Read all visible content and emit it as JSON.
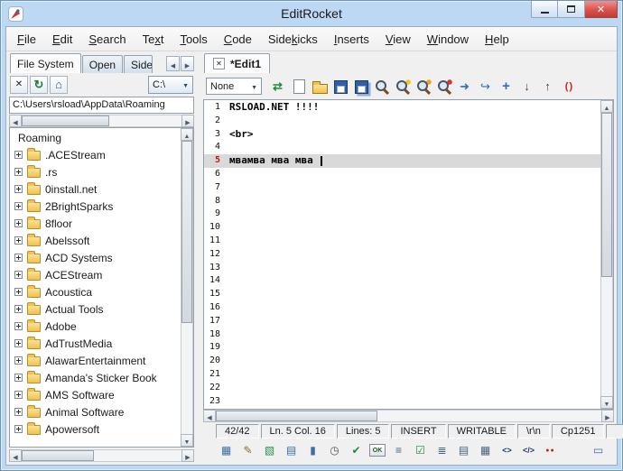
{
  "colors": {
    "titlebar": "#bdd8f2",
    "close_button": "#d9534f",
    "folder_yellow": "#f2c14e",
    "current_line_bg": "#d9d9d9",
    "current_line_number": "#cc1111",
    "accent_blue": "#2a6fc0"
  },
  "window": {
    "title": "EditRocket"
  },
  "menu": {
    "items": [
      {
        "pre": "",
        "u": "F",
        "post": "ile"
      },
      {
        "pre": "",
        "u": "E",
        "post": "dit"
      },
      {
        "pre": "",
        "u": "S",
        "post": "earch"
      },
      {
        "pre": "Te",
        "u": "x",
        "post": "t"
      },
      {
        "pre": "",
        "u": "T",
        "post": "ools"
      },
      {
        "pre": "",
        "u": "C",
        "post": "ode"
      },
      {
        "pre": "Side",
        "u": "k",
        "post": "icks"
      },
      {
        "pre": "",
        "u": "I",
        "post": "nserts"
      },
      {
        "pre": "",
        "u": "V",
        "post": "iew"
      },
      {
        "pre": "",
        "u": "W",
        "post": "indow"
      },
      {
        "pre": "",
        "u": "H",
        "post": "elp"
      }
    ]
  },
  "sidebar": {
    "tabs": [
      {
        "label": "File System",
        "active": true,
        "clip": false
      },
      {
        "label": "Open",
        "active": false,
        "clip": false
      },
      {
        "label": "Side",
        "active": false,
        "clip": true
      }
    ],
    "toolbar_icons": [
      {
        "name": "close-panel-icon",
        "glyph": "✕"
      },
      {
        "name": "refresh-icon",
        "glyph": "↻"
      },
      {
        "name": "home-icon",
        "glyph": "⌂"
      }
    ],
    "drive": "C:\\",
    "path": "C:\\Users\\rsload\\AppData\\Roaming",
    "tree_root": "Roaming",
    "folders": [
      ".ACEStream",
      ".rs",
      "0install.net",
      "2BrightSparks",
      "8floor",
      "Abelssoft",
      "ACD Systems",
      "ACEStream",
      "Acoustica",
      "Actual Tools",
      "Adobe",
      "AdTrustMedia",
      "AlawarEntertainment",
      "Amanda's Sticker Book",
      "AMS Software",
      "Animal Software",
      "Apowersoft"
    ]
  },
  "editor": {
    "tab": "*Edit1",
    "syntax_mode": "None",
    "toolbar_icons": [
      {
        "name": "connect-icon",
        "glyph": "⇄"
      },
      {
        "name": "new-file-icon",
        "glyph": ""
      },
      {
        "name": "open-file-icon",
        "glyph": ""
      },
      {
        "name": "save-icon",
        "glyph": ""
      },
      {
        "name": "save-all-icon",
        "glyph": ""
      },
      {
        "name": "find-icon",
        "glyph": ""
      },
      {
        "name": "find-next-icon",
        "glyph": ""
      },
      {
        "name": "find-prev-icon",
        "glyph": ""
      },
      {
        "name": "replace-icon",
        "glyph": ""
      },
      {
        "name": "goto-icon",
        "glyph": "➜"
      },
      {
        "name": "jump-line-icon",
        "glyph": "↪"
      },
      {
        "name": "insert-icon",
        "glyph": "+"
      },
      {
        "name": "move-down-icon",
        "glyph": "↓"
      },
      {
        "name": "move-up-icon",
        "glyph": "↑"
      },
      {
        "name": "match-brace-icon",
        "glyph": "( )"
      }
    ],
    "lines": [
      {
        "n": 1,
        "text": "RSLOAD.NET !!!!",
        "current": false
      },
      {
        "n": 2,
        "text": "",
        "current": false
      },
      {
        "n": 3,
        "text": "<br>",
        "current": false
      },
      {
        "n": 4,
        "text": "",
        "current": false
      },
      {
        "n": 5,
        "text": "мвамва мва мва",
        "current": true
      },
      {
        "n": 6,
        "text": "",
        "current": false
      },
      {
        "n": 7,
        "text": "",
        "current": false
      },
      {
        "n": 8,
        "text": "",
        "current": false
      },
      {
        "n": 9,
        "text": "",
        "current": false
      },
      {
        "n": 10,
        "text": "",
        "current": false
      },
      {
        "n": 11,
        "text": "",
        "current": false
      },
      {
        "n": 12,
        "text": "",
        "current": false
      },
      {
        "n": 13,
        "text": "",
        "current": false
      },
      {
        "n": 14,
        "text": "",
        "current": false
      },
      {
        "n": 15,
        "text": "",
        "current": false
      },
      {
        "n": 16,
        "text": "",
        "current": false
      },
      {
        "n": 17,
        "text": "",
        "current": false
      },
      {
        "n": 18,
        "text": "",
        "current": false
      },
      {
        "n": 19,
        "text": "",
        "current": false
      },
      {
        "n": 20,
        "text": "",
        "current": false
      },
      {
        "n": 21,
        "text": "",
        "current": false
      },
      {
        "n": 22,
        "text": "",
        "current": false
      },
      {
        "n": 23,
        "text": "",
        "current": false
      }
    ]
  },
  "status": {
    "position": "42/42",
    "cursor": "Ln. 5 Col. 16",
    "line_count": "Lines: 5",
    "mode": "INSERT",
    "writable": "WRITABLE",
    "line_ending": "\\r\\n",
    "encoding": "Cp1251"
  },
  "bottom_toolbar_icons": [
    {
      "name": "table-icon",
      "glyph": "▦"
    },
    {
      "name": "edit-pencil-icon",
      "glyph": "✎"
    },
    {
      "name": "spellcheck-icon",
      "glyph": "▧"
    },
    {
      "name": "notes-icon",
      "glyph": "▤"
    },
    {
      "name": "marker-icon",
      "glyph": "▮"
    },
    {
      "name": "clock-icon",
      "glyph": "◷"
    },
    {
      "name": "check-icon",
      "glyph": "✔"
    },
    {
      "name": "ok-icon",
      "glyph": "OK"
    },
    {
      "name": "list-icon",
      "glyph": "≡"
    },
    {
      "name": "checklist-icon",
      "glyph": "☑"
    },
    {
      "name": "bullet-list-icon",
      "glyph": "≣"
    },
    {
      "name": "outline-icon",
      "glyph": "▤"
    },
    {
      "name": "grid-icon",
      "glyph": "▦"
    },
    {
      "name": "code-tags-icon",
      "glyph": "<>"
    },
    {
      "name": "tag-pair-icon",
      "glyph": "</>"
    },
    {
      "name": "breakpoints-icon",
      "glyph": "●●"
    },
    {
      "name": "screen-icon",
      "glyph": "▭"
    }
  ]
}
